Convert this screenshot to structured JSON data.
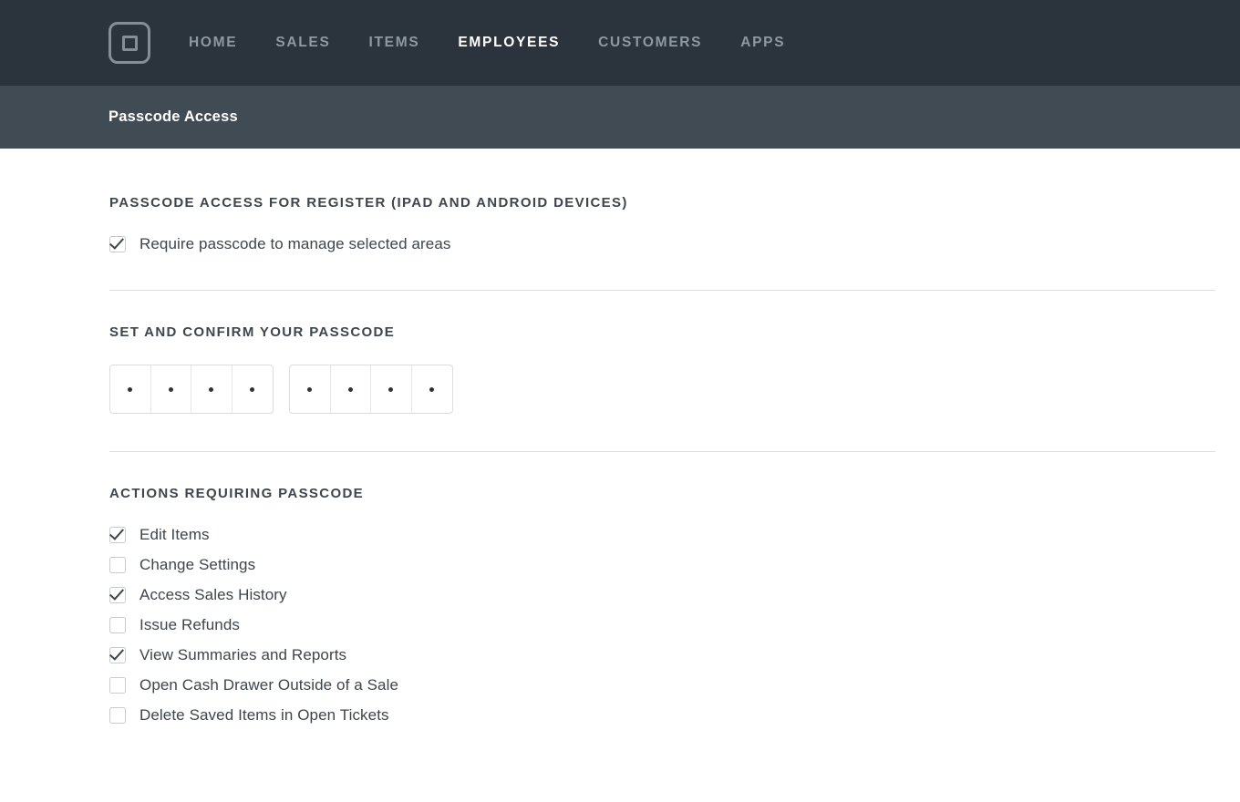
{
  "nav": {
    "logo_name": "square-logo",
    "items": [
      {
        "label": "HOME",
        "active": false
      },
      {
        "label": "SALES",
        "active": false
      },
      {
        "label": "ITEMS",
        "active": false
      },
      {
        "label": "EMPLOYEES",
        "active": true
      },
      {
        "label": "CUSTOMERS",
        "active": false
      },
      {
        "label": "APPS",
        "active": false
      }
    ]
  },
  "subheader": {
    "title": "Passcode Access"
  },
  "sections": {
    "register": {
      "title": "PASSCODE ACCESS FOR REGISTER (IPAD AND ANDROID DEVICES)",
      "require_passcode": {
        "label": "Require passcode to manage selected areas",
        "checked": true
      }
    },
    "passcode": {
      "title": "SET AND CONFIRM YOUR PASSCODE",
      "set_field": {
        "name": "set-passcode",
        "cells": [
          "•",
          "•",
          "•",
          "•"
        ]
      },
      "confirm_field": {
        "name": "confirm-passcode",
        "cells": [
          "•",
          "•",
          "•",
          "•"
        ]
      }
    },
    "actions": {
      "title": "ACTIONS REQUIRING PASSCODE",
      "items": [
        {
          "label": "Edit Items",
          "checked": true
        },
        {
          "label": "Change Settings",
          "checked": false
        },
        {
          "label": "Access Sales History",
          "checked": true
        },
        {
          "label": "Issue Refunds",
          "checked": false
        },
        {
          "label": "View Summaries and Reports",
          "checked": true
        },
        {
          "label": "Open Cash Drawer Outside of a Sale",
          "checked": false
        },
        {
          "label": "Delete Saved Items in Open Tickets",
          "checked": false
        }
      ]
    }
  },
  "colors": {
    "topnav_bg": "#2b343c",
    "subheader_bg": "#414b54",
    "nav_inactive": "#8d98a2",
    "nav_active": "#ffffff",
    "text": "#3d454d",
    "divider": "#dcdedf",
    "checkbox_border": "#c9ccce"
  }
}
